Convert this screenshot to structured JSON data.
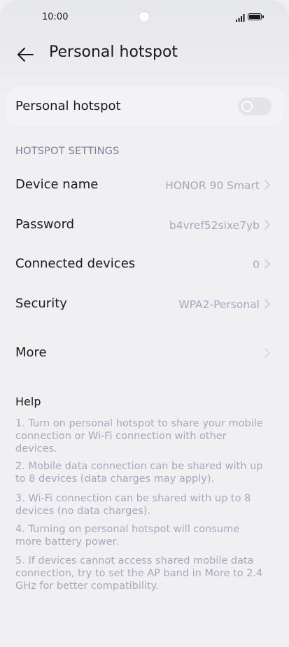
{
  "status_bar": {
    "time": "10:00"
  },
  "header": {
    "title": "Personal hotspot"
  },
  "hotspot": {
    "label": "Personal hotspot",
    "enabled": false
  },
  "settings": {
    "section_title": "HOTSPOT SETTINGS",
    "rows": [
      {
        "label": "Device name",
        "value": "HONOR 90 Smart"
      },
      {
        "label": "Password",
        "value": "b4vref52sixe7yb"
      },
      {
        "label": "Connected devices",
        "value": "0"
      },
      {
        "label": "Security",
        "value": "WPA2-Personal"
      }
    ],
    "more_label": "More"
  },
  "help": {
    "title": "Help",
    "items": [
      "1. Turn on personal hotspot to share your mobile connection or Wi-Fi connection with other devices.",
      "2. Mobile data connection can be shared with up to 8 devices (data charges may apply).",
      "3. Wi-Fi connection can be shared with up to 8 devices (no data charges).",
      "4. Turning on personal hotspot will consume more battery power.",
      "5. If devices cannot access shared mobile data connection, try to set the AP band in More to 2.4 GHz for better compatibility."
    ]
  },
  "colors": {
    "primary_text": "#1a1a1a",
    "secondary_text": "#a6a8bb",
    "section_header": "#7c7f9a"
  }
}
